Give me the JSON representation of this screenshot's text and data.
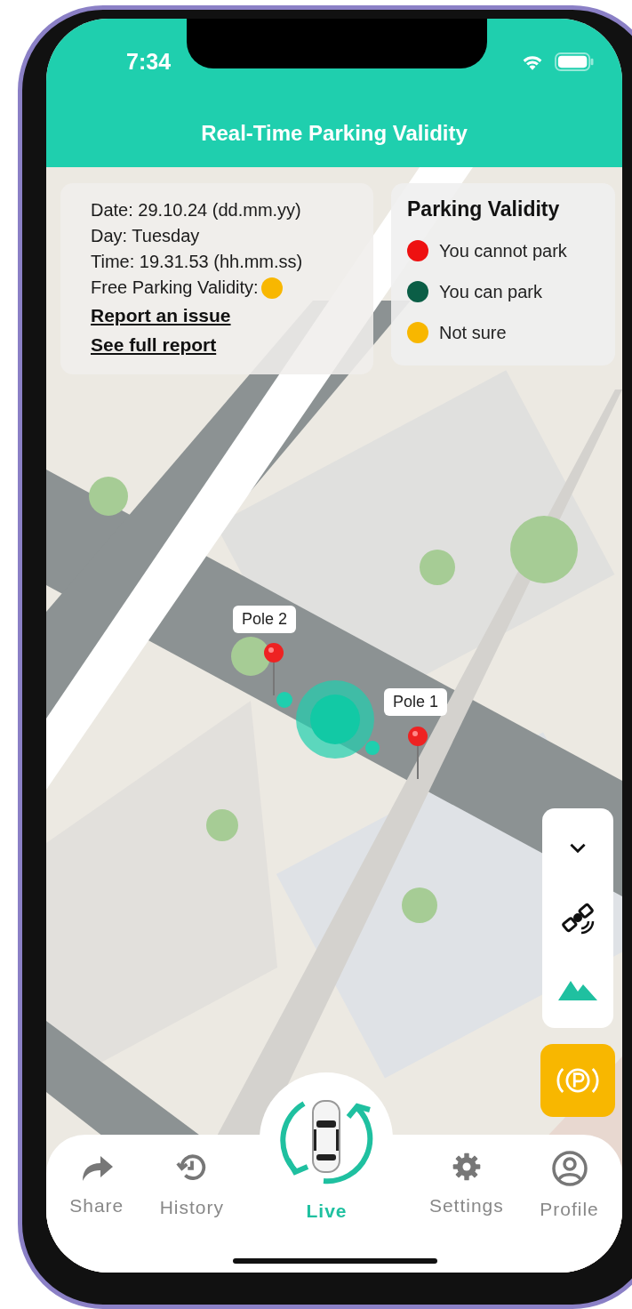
{
  "status_bar": {
    "time": "7:34"
  },
  "header": {
    "title": "Real-Time Parking Validity"
  },
  "info_card": {
    "lines": [
      "Date: 29.10.24 (dd.mm.yy)",
      "Day: Tuesday",
      "Time: 19.31.53 (hh.mm.ss)"
    ],
    "validity": {
      "label": "Free Parking Validity:",
      "color": "#f8b700"
    },
    "links": [
      "Report an issue",
      "See full report"
    ]
  },
  "legend": {
    "title": "Parking Validity",
    "items": [
      {
        "label": "You cannot park",
        "color": "#ee1111"
      },
      {
        "label": "You can park",
        "color": "#0b5e46"
      },
      {
        "label": "Not sure",
        "color": "#f8b700"
      }
    ]
  },
  "map": {
    "kind": "picture",
    "markers": [
      {
        "label": "Pole 2"
      },
      {
        "label": "Pole 1"
      }
    ]
  },
  "tab_bar": {
    "tabs": [
      {
        "label": "Share",
        "kind": "share",
        "selected": false
      },
      {
        "label": "History",
        "kind": "history",
        "selected": false
      },
      {
        "label": "Live",
        "kind": "live",
        "selected": true
      },
      {
        "label": "Settings",
        "kind": "settings",
        "selected": false
      },
      {
        "label": "Profile",
        "kind": "profile",
        "selected": false
      }
    ]
  }
}
